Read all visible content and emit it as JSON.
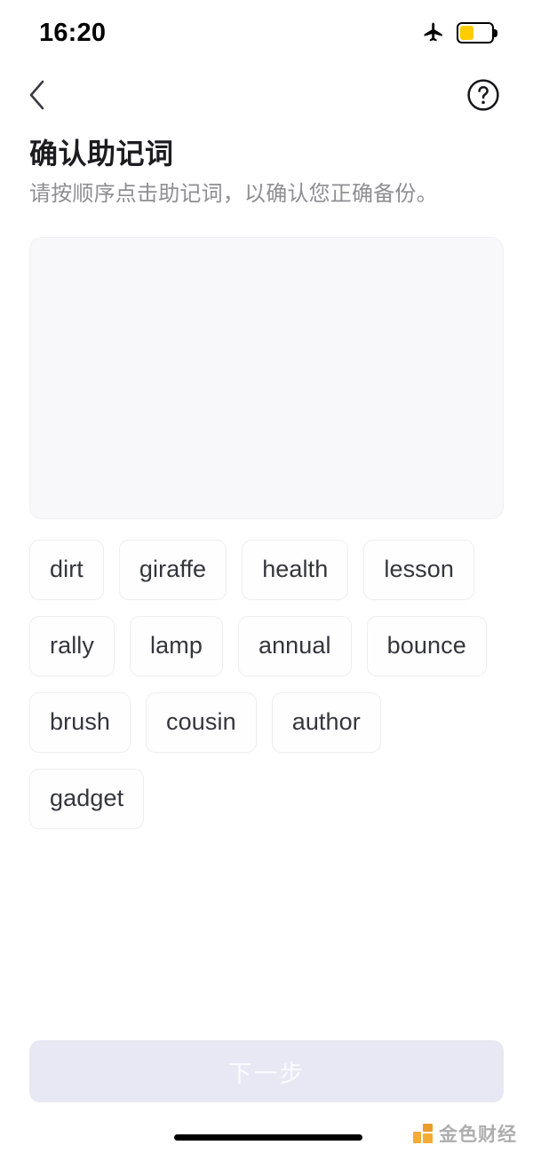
{
  "status_bar": {
    "time": "16:20",
    "airplane_icon": "airplane-mode-icon",
    "battery_icon": "battery-icon",
    "battery_level_percent": 45,
    "battery_fill_color": "#ffcc00",
    "battery_outline_color": "#000000"
  },
  "nav": {
    "back_icon": "chevron-left-icon",
    "help_icon": "question-mark-circle-icon"
  },
  "header": {
    "title": "确认助记词",
    "subtitle": "请按顺序点击助记词，以确认您正确备份。"
  },
  "dropzone": {
    "selected_words": [],
    "background_color": "#f8f8fa",
    "border_color": "#f0f0f2"
  },
  "word_bank": {
    "words": [
      "dirt",
      "giraffe",
      "health",
      "lesson",
      "rally",
      "lamp",
      "annual",
      "bounce",
      "brush",
      "cousin",
      "author",
      "gadget"
    ]
  },
  "footer": {
    "next_button_label": "下一步",
    "next_button_enabled": false,
    "next_button_color": "#e8e8f4",
    "next_button_text_color": "#fafaff"
  },
  "watermark": {
    "text": "金色财经",
    "mark_color": "#f5a623",
    "mark_color_alt": "#e8951c"
  },
  "home_indicator": {
    "color": "#000000"
  }
}
